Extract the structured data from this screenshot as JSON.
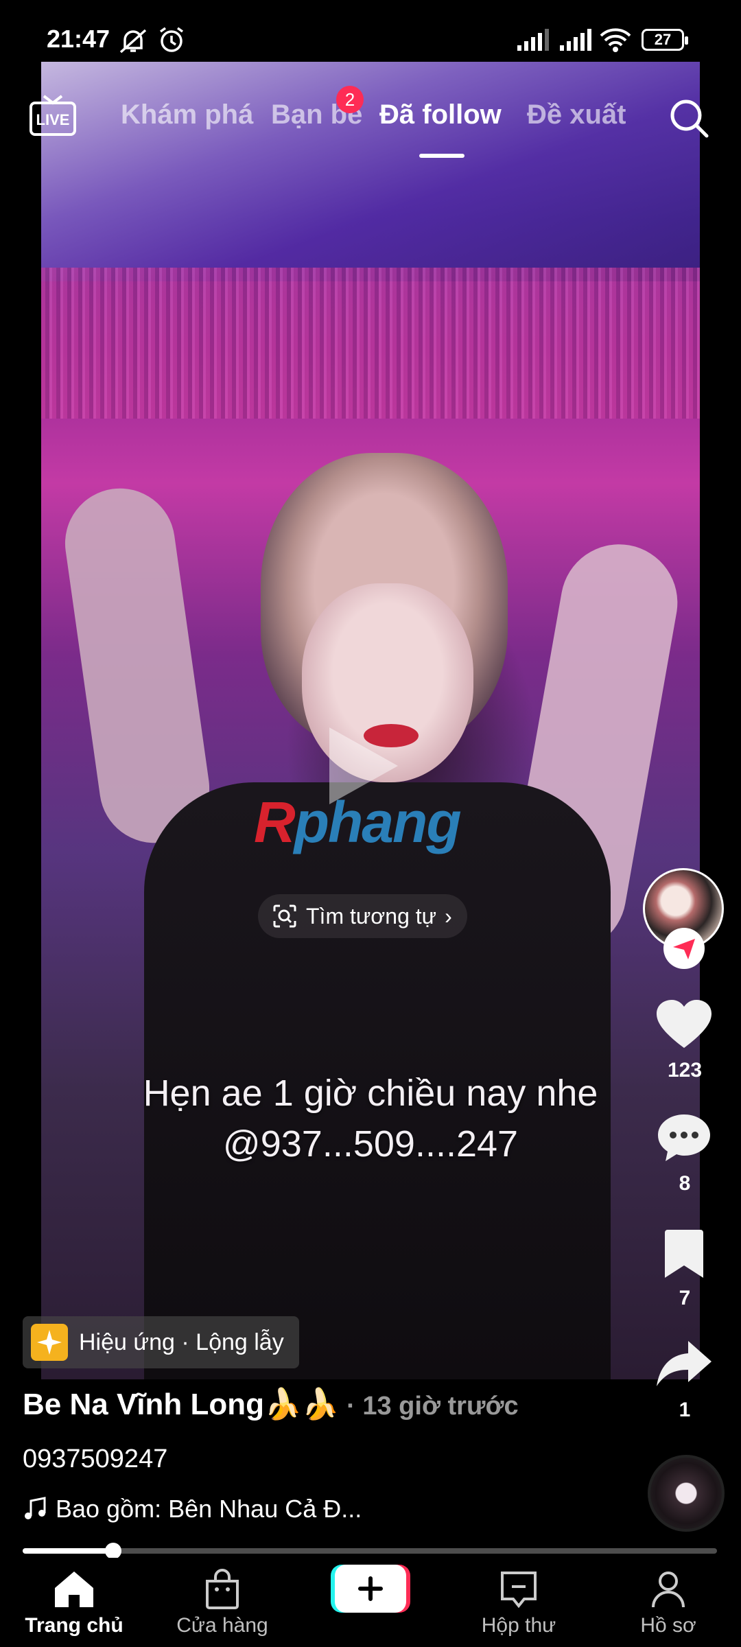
{
  "status_bar": {
    "time": "21:47",
    "battery": "27"
  },
  "top_nav": {
    "tabs": [
      {
        "label": "Khám phá"
      },
      {
        "label": "Bạn bè",
        "badge": "2"
      },
      {
        "label": "Đã follow"
      },
      {
        "label": "Đề xuất"
      }
    ],
    "active_tab": "Đã follow"
  },
  "video": {
    "watermark": {
      "part1": "R",
      "part2": "phang"
    },
    "find_similar_label": "Tìm tương tự",
    "caption_line1": "Hẹn ae 1 giờ chiều nay nhe",
    "caption_line2": "@937...509....247",
    "progress": 0.13
  },
  "rail": {
    "likes": "123",
    "comments": "8",
    "saves": "7",
    "shares": "1"
  },
  "effect": {
    "label": "Hiệu ứng · Lộng lẫy"
  },
  "post": {
    "author": "Be Na Vĩnh Long🍌🍌",
    "time": " · 13 giờ trước",
    "description": "0937509247",
    "music": "Bao gồm: Bên Nhau Cả Đ..."
  },
  "bottom_nav": {
    "home": "Trang chủ",
    "shop": "Cửa hàng",
    "inbox": "Hộp thư",
    "profile": "Hồ sơ"
  }
}
